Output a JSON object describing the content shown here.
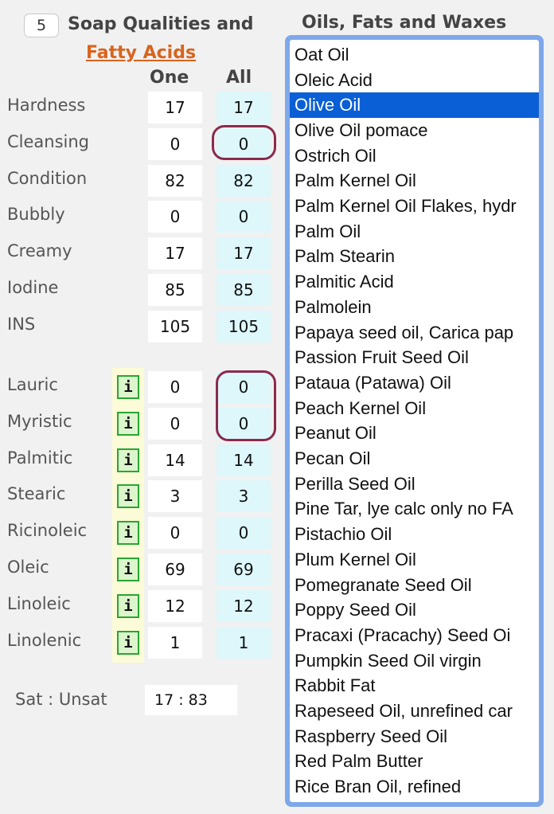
{
  "qualities": {
    "count_badge": "5",
    "title": "Soap Qualities and",
    "link": "Fatty Acids",
    "col_one": "One",
    "col_all": "All",
    "rows": [
      {
        "label": "Hardness",
        "one": "17",
        "all": "17"
      },
      {
        "label": "Cleansing",
        "one": "0",
        "all": "0"
      },
      {
        "label": "Condition",
        "one": "82",
        "all": "82"
      },
      {
        "label": "Bubbly",
        "one": "0",
        "all": "0"
      },
      {
        "label": "Creamy",
        "one": "17",
        "all": "17"
      },
      {
        "label": "Iodine",
        "one": "85",
        "all": "85"
      },
      {
        "label": "INS",
        "one": "105",
        "all": "105"
      }
    ]
  },
  "fatty_acids": {
    "info_glyph": "i",
    "rows": [
      {
        "label": "Lauric",
        "one": "0",
        "all": "0"
      },
      {
        "label": "Myristic",
        "one": "0",
        "all": "0"
      },
      {
        "label": "Palmitic",
        "one": "14",
        "all": "14"
      },
      {
        "label": "Stearic",
        "one": "3",
        "all": "3"
      },
      {
        "label": "Ricinoleic",
        "one": "0",
        "all": "0"
      },
      {
        "label": "Oleic",
        "one": "69",
        "all": "69"
      },
      {
        "label": "Linoleic",
        "one": "12",
        "all": "12"
      },
      {
        "label": "Linolenic",
        "one": "1",
        "all": "1"
      }
    ]
  },
  "ratio": {
    "label": "Sat : Unsat",
    "value": "17 : 83"
  },
  "oils": {
    "title": "Oils, Fats and Waxes",
    "selected": "Olive Oil",
    "items": [
      "Oat Oil",
      "Oleic Acid",
      "Olive Oil",
      "Olive Oil pomace",
      "Ostrich Oil",
      "Palm Kernel Oil",
      "Palm Kernel Oil Flakes, hydr",
      "Palm Oil",
      "Palm Stearin",
      "Palmitic Acid",
      "Palmolein",
      "Papaya seed oil, Carica pap",
      "Passion Fruit Seed Oil",
      "Pataua (Patawa) Oil",
      "Peach Kernel Oil",
      "Peanut Oil",
      "Pecan Oil",
      "Perilla Seed Oil",
      "Pine Tar, lye calc only no FA",
      "Pistachio Oil",
      "Plum Kernel Oil",
      "Pomegranate Seed Oil",
      "Poppy Seed Oil",
      "Pracaxi (Pracachy) Seed Oi",
      "Pumpkin Seed Oil virgin",
      "Rabbit Fat",
      "Rapeseed Oil, unrefined car",
      "Raspberry Seed Oil",
      "Red Palm Butter",
      "Rice Bran Oil, refined"
    ]
  },
  "colors": {
    "link": "#d9641d",
    "all_column_bg": "#ddf7fb",
    "highlight_oval": "#8a2a4d",
    "selection": "#0a5fd6",
    "list_border": "#7fa8eb"
  }
}
